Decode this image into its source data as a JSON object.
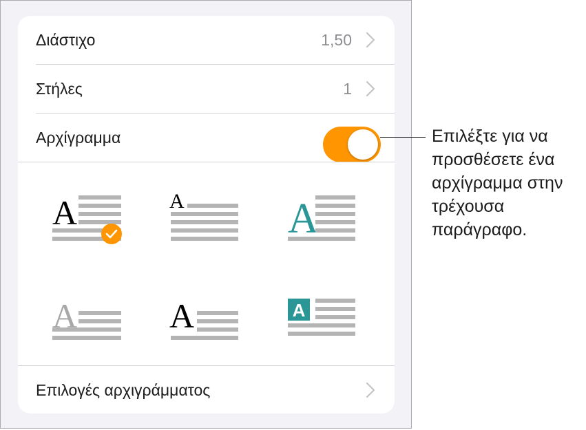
{
  "rows": {
    "spacing": {
      "label": "Διάστιχο",
      "value": "1,50"
    },
    "columns": {
      "label": "Στήλες",
      "value": "1"
    },
    "dropcap": {
      "label": "Αρχίγραμμα",
      "on": true
    },
    "options": {
      "label": "Επιλογές αρχιγράμματος"
    }
  },
  "styles": [
    {
      "letter": "A",
      "icon": "dropcap-style-large-serif-icon",
      "selected": true
    },
    {
      "letter": "A",
      "icon": "dropcap-style-small-serif-icon",
      "selected": false
    },
    {
      "letter": "A",
      "icon": "dropcap-style-teal-serif-icon",
      "selected": false
    },
    {
      "letter": "A",
      "icon": "dropcap-style-gray-serif-icon",
      "selected": false
    },
    {
      "letter": "A",
      "icon": "dropcap-style-raised-serif-icon",
      "selected": false
    },
    {
      "letter": "A",
      "icon": "dropcap-style-boxed-teal-icon",
      "selected": false
    }
  ],
  "callout": "Επιλέξτε για να προσθέσετε ένα αρχίγραμμα στην τρέχουσα παράγραφο.",
  "colors": {
    "accent": "#ff9500",
    "teal": "#2a9696",
    "line": "#b4b4b4",
    "chevron": "#c4c4c7"
  }
}
